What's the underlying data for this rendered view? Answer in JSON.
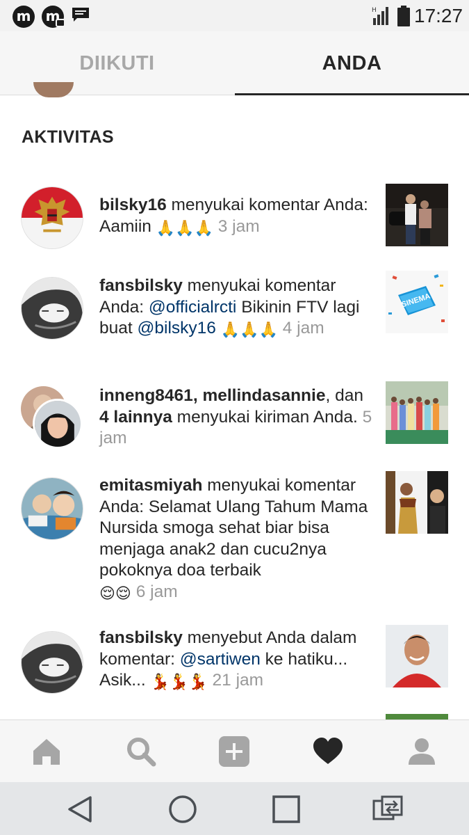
{
  "status_bar": {
    "time": "17:27",
    "icons": [
      "m-app-icon",
      "m-camera-app-icon",
      "message-icon",
      "signal-icon",
      "battery-icon"
    ]
  },
  "tabs": [
    {
      "label": "DIIKUTI",
      "active": false
    },
    {
      "label": "ANDA",
      "active": true
    }
  ],
  "section_title": "AKTIVITAS",
  "activities": [
    {
      "user": "bilsky16",
      "action": " menyukai komentar Anda: Aamiin",
      "emoji": "🙏🙏🙏",
      "time": "3 jam"
    },
    {
      "user": "fansbilsky",
      "action_a": " menyukai komentar Anda: ",
      "mention_a": "@officialrcti",
      "action_b": " Bikinin FTV lagi buat ",
      "mention_b": "@bilsky16",
      "emoji": "🙏🙏🙏",
      "time": "4 jam"
    },
    {
      "user_a": "inneng8461",
      "sep_a": ", ",
      "user_b": "mellindasannie",
      "sep_b": ", dan ",
      "others": "4 lainnya",
      "action": " menyukai kiriman Anda.",
      "time": "5 jam"
    },
    {
      "user": "emitasmiyah",
      "action": " menyukai komentar Anda: Selamat Ulang Tahum Mama Nursida smoga sehat biar bisa menjaga anak2 dan cucu2nya  pokoknya doa terbaik",
      "emoji": "😌😌",
      "time": "6 jam"
    },
    {
      "user": "fansbilsky",
      "action_a": " menyebut Anda dalam komentar: ",
      "mention": "@sartiwen",
      "action_b": " ke hatiku... Asik...",
      "emoji": "💃💃💃",
      "time": "21 jam"
    }
  ],
  "thumb_labels": {
    "sinema": "SINEMA"
  },
  "bottom_nav": [
    "home-icon",
    "search-icon",
    "add-icon",
    "heart-icon",
    "profile-icon"
  ],
  "android_nav": [
    "back-icon",
    "home-circle-icon",
    "recents-icon",
    "switch-icon"
  ],
  "colors": {
    "mention": "#003569",
    "time": "#999999",
    "text": "#262626"
  }
}
